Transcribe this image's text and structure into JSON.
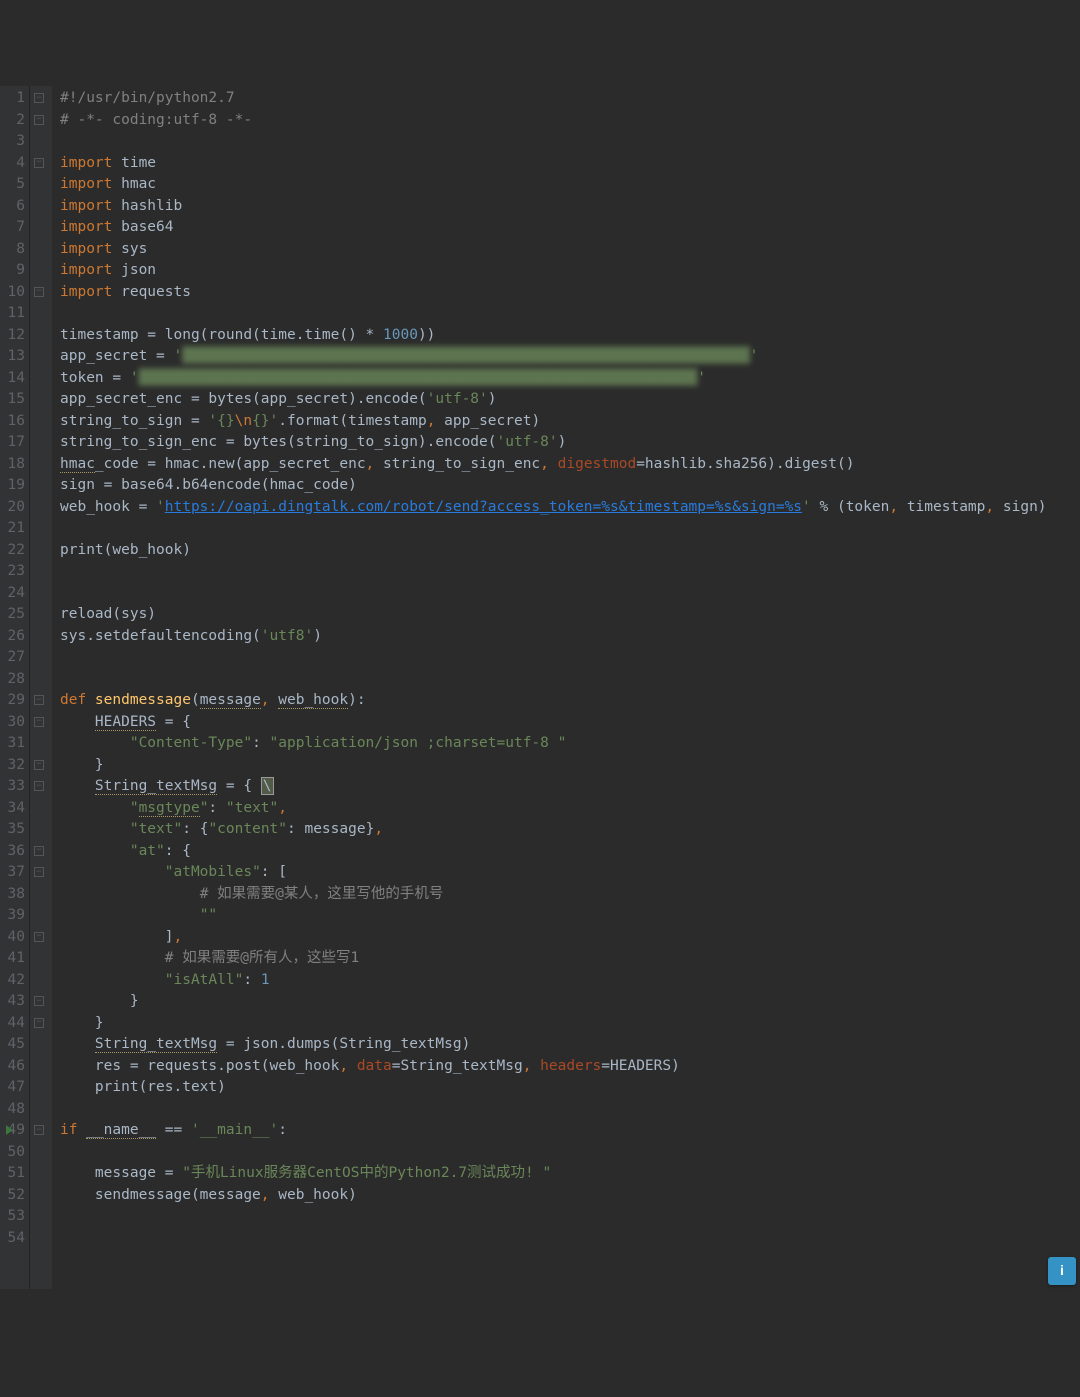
{
  "info_bubble_label": "i",
  "code_lines": [
    [
      {
        "t": "#!/usr/bin/python2.7",
        "cls": "c-cmt"
      }
    ],
    [
      {
        "t": "# -*- coding:utf-8 -*-",
        "cls": "c-cmt"
      }
    ],
    [],
    [
      {
        "t": "import ",
        "cls": "c-kw"
      },
      {
        "t": "time"
      }
    ],
    [
      {
        "t": "import ",
        "cls": "c-kw"
      },
      {
        "t": "hmac"
      }
    ],
    [
      {
        "t": "import ",
        "cls": "c-kw"
      },
      {
        "t": "hashlib"
      }
    ],
    [
      {
        "t": "import ",
        "cls": "c-kw"
      },
      {
        "t": "base64"
      }
    ],
    [
      {
        "t": "import ",
        "cls": "c-kw"
      },
      {
        "t": "sys"
      }
    ],
    [
      {
        "t": "import ",
        "cls": "c-kw"
      },
      {
        "t": "json"
      }
    ],
    [
      {
        "t": "import ",
        "cls": "c-kw"
      },
      {
        "t": "requests"
      }
    ],
    [],
    [
      {
        "t": "timestamp = long(round(time.time() * "
      },
      {
        "t": "1000",
        "cls": "c-num"
      },
      {
        "t": "))"
      }
    ],
    [
      {
        "t": "app_secret = "
      },
      {
        "t": "'",
        "cls": "c-str"
      },
      {
        "t": "█████████████████████████████████████████████████████████████████",
        "cls": "c-str obscured"
      },
      {
        "t": "'",
        "cls": "c-str"
      }
    ],
    [
      {
        "t": "token = "
      },
      {
        "t": "'",
        "cls": "c-str"
      },
      {
        "t": "████████████████████████████████████████████████████████████████",
        "cls": "c-str obscured"
      },
      {
        "t": "'",
        "cls": "c-str"
      }
    ],
    [
      {
        "t": "app_secret_enc = bytes(app_secret).encode("
      },
      {
        "t": "'utf-8'",
        "cls": "c-str"
      },
      {
        "t": ")"
      }
    ],
    [
      {
        "t": "string_to_sign = "
      },
      {
        "t": "'{}",
        "cls": "c-str"
      },
      {
        "t": "\\n",
        "cls": "c-kw"
      },
      {
        "t": "{}'",
        "cls": "c-str"
      },
      {
        "t": ".format(timestamp"
      },
      {
        "t": ", ",
        "cls": "c-kw"
      },
      {
        "t": "app_secret)"
      }
    ],
    [
      {
        "t": "string_to_sign_enc = bytes(string_to_sign).encode("
      },
      {
        "t": "'utf-8'",
        "cls": "c-str"
      },
      {
        "t": ")"
      }
    ],
    [
      {
        "t": "hmac",
        "cls": "c-ul"
      },
      {
        "t": "_code = hmac.new(app_secret_enc"
      },
      {
        "t": ", ",
        "cls": "c-kw"
      },
      {
        "t": "string_to_sign_enc"
      },
      {
        "t": ", ",
        "cls": "c-kw"
      },
      {
        "t": "digestmod",
        "cls": "c-kwarg"
      },
      {
        "t": "=hashlib.sha256).digest()"
      }
    ],
    [
      {
        "t": "sign = base64.b64encode(hmac_code)"
      }
    ],
    [
      {
        "t": "web_hook = "
      },
      {
        "t": "'",
        "cls": "c-str"
      },
      {
        "t": "https://oapi.dingtalk.com/robot/send?access_token=%s&timestamp=%s&sign=%s",
        "cls": "c-link"
      },
      {
        "t": "'",
        "cls": "c-str"
      },
      {
        "t": " % (token"
      },
      {
        "t": ", ",
        "cls": "c-kw"
      },
      {
        "t": "timestamp"
      },
      {
        "t": ", ",
        "cls": "c-kw"
      },
      {
        "t": "sign)"
      }
    ],
    [],
    [
      {
        "t": "print(web_hook)"
      }
    ],
    [],
    [],
    [
      {
        "t": "reload(sys)"
      }
    ],
    [
      {
        "t": "sys.setdefaultencoding("
      },
      {
        "t": "'utf8'",
        "cls": "c-str"
      },
      {
        "t": ")"
      }
    ],
    [],
    [],
    [
      {
        "t": "def ",
        "cls": "c-kw"
      },
      {
        "t": "sendmessage",
        "cls": "c-def"
      },
      {
        "t": "("
      },
      {
        "t": "message",
        "cls": "c-ul"
      },
      {
        "t": ", ",
        "cls": "c-kw"
      },
      {
        "t": "web_hook",
        "cls": "c-ul"
      },
      {
        "t": "):"
      }
    ],
    [
      {
        "t": "    "
      },
      {
        "t": "HEADERS",
        "cls": "c-ul"
      },
      {
        "t": " = {"
      }
    ],
    [
      {
        "t": "        "
      },
      {
        "t": "\"Content-Type\"",
        "cls": "c-str"
      },
      {
        "t": ": "
      },
      {
        "t": "\"application/json ;charset=utf-8 \"",
        "cls": "c-str"
      }
    ],
    [
      {
        "t": "    }"
      }
    ],
    [
      {
        "t": "    "
      },
      {
        "t": "String_textMsg",
        "cls": "c-ul"
      },
      {
        "t": " = { "
      },
      {
        "t": "\\",
        "cls": "caret-box"
      }
    ],
    [
      {
        "t": "        "
      },
      {
        "t": "\"",
        "cls": "c-str"
      },
      {
        "t": "msgtype",
        "cls": "c-str c-ul"
      },
      {
        "t": "\"",
        "cls": "c-str"
      },
      {
        "t": ": "
      },
      {
        "t": "\"text\"",
        "cls": "c-str"
      },
      {
        "t": ",",
        "cls": "c-kw"
      }
    ],
    [
      {
        "t": "        "
      },
      {
        "t": "\"text\"",
        "cls": "c-str"
      },
      {
        "t": ": {"
      },
      {
        "t": "\"content\"",
        "cls": "c-str"
      },
      {
        "t": ": message}"
      },
      {
        "t": ",",
        "cls": "c-kw"
      }
    ],
    [
      {
        "t": "        "
      },
      {
        "t": "\"at\"",
        "cls": "c-str"
      },
      {
        "t": ": {"
      }
    ],
    [
      {
        "t": "            "
      },
      {
        "t": "\"atMobiles\"",
        "cls": "c-str"
      },
      {
        "t": ": ["
      }
    ],
    [
      {
        "t": "                "
      },
      {
        "t": "# 如果需要@某人，这里写他的手机号",
        "cls": "c-cmt"
      }
    ],
    [
      {
        "t": "                "
      },
      {
        "t": "\"\"",
        "cls": "c-str"
      }
    ],
    [
      {
        "t": "            ]"
      },
      {
        "t": ",",
        "cls": "c-kw"
      }
    ],
    [
      {
        "t": "            "
      },
      {
        "t": "# 如果需要@所有人，这些写1",
        "cls": "c-cmt"
      }
    ],
    [
      {
        "t": "            "
      },
      {
        "t": "\"isAtAll\"",
        "cls": "c-str"
      },
      {
        "t": ": "
      },
      {
        "t": "1",
        "cls": "c-num"
      }
    ],
    [
      {
        "t": "        }"
      }
    ],
    [
      {
        "t": "    }"
      }
    ],
    [
      {
        "t": "    "
      },
      {
        "t": "String_textMsg",
        "cls": "c-ul"
      },
      {
        "t": " = json.dumps(String_textMsg)"
      }
    ],
    [
      {
        "t": "    res = requests.post(web_hook"
      },
      {
        "t": ", ",
        "cls": "c-kw"
      },
      {
        "t": "data",
        "cls": "c-kwarg"
      },
      {
        "t": "=String_textMsg"
      },
      {
        "t": ", ",
        "cls": "c-kw"
      },
      {
        "t": "headers",
        "cls": "c-kwarg"
      },
      {
        "t": "=HEADERS)"
      }
    ],
    [
      {
        "t": "    print(res.text)"
      }
    ],
    [],
    [
      {
        "t": "if ",
        "cls": "c-kw"
      },
      {
        "t": "__name__",
        "cls": "c-ul"
      },
      {
        "t": " == "
      },
      {
        "t": "'__main__'",
        "cls": "c-str"
      },
      {
        "t": ":"
      }
    ],
    [],
    [
      {
        "t": "    message = "
      },
      {
        "t": "\"手机Linux服务器CentOS中的Python2.7测试成功! \"",
        "cls": "c-str"
      }
    ],
    [
      {
        "t": "    sendmessage(message"
      },
      {
        "t": ", ",
        "cls": "c-kw"
      },
      {
        "t": "web_hook)"
      }
    ],
    [],
    []
  ],
  "fold_markers": [
    1,
    2,
    4,
    10,
    29,
    30,
    32,
    33,
    36,
    37,
    40,
    43,
    44,
    49
  ],
  "run_marker_line": 49
}
